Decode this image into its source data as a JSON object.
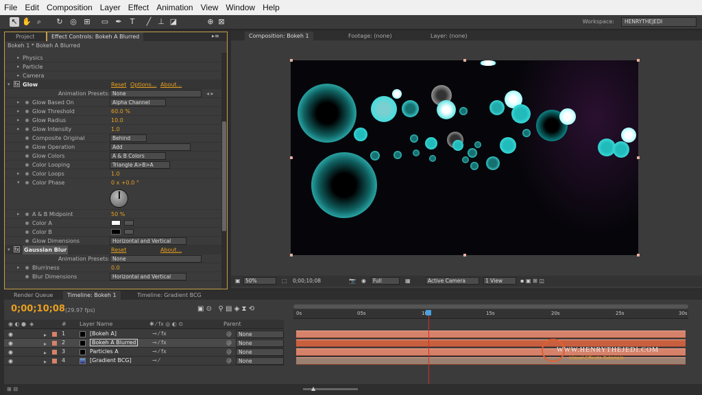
{
  "menu": [
    "File",
    "Edit",
    "Composition",
    "Layer",
    "Effect",
    "Animation",
    "View",
    "Window",
    "Help"
  ],
  "workspace": {
    "label": "Workspace:",
    "value": "HENRYTHEJEDI"
  },
  "left_tabs": {
    "project": "Project",
    "effect_controls": "Effect Controls: Bokeh A Blurred"
  },
  "fx_header": "Bokeh 1 * Bokeh A Blurred",
  "fx_groups": {
    "physics": "Physics",
    "particle": "Particle",
    "camera": "Camera"
  },
  "glow": {
    "title": "Glow",
    "reset": "Reset",
    "options": "Options...",
    "about": "About...",
    "presets_label": "Animation Presets:",
    "presets_value": "None",
    "based_on_label": "Glow Based On",
    "based_on": "Alpha Channel",
    "threshold_label": "Glow Threshold",
    "threshold": "60.0 %",
    "radius_label": "Glow Radius",
    "radius": "10.0",
    "intensity_label": "Glow Intensity",
    "intensity": "1.0",
    "composite_label": "Composite Original",
    "composite": "Behind",
    "operation_label": "Glow Operation",
    "operation": "Add",
    "colors_label": "Glow Colors",
    "colors": "A & B Colors",
    "looping_label": "Color Looping",
    "looping": "Triangle A>B>A",
    "loops_label": "Color Loops",
    "loops": "1.0",
    "phase_label": "Color Phase",
    "phase": "0 x +0.0 °",
    "midpoint_label": "A & B Midpoint",
    "midpoint": "50 %",
    "color_a_label": "Color A",
    "color_b_label": "Color B",
    "dimensions_label": "Glow Dimensions",
    "dimensions": "Horizontal and Vertical"
  },
  "blur": {
    "title": "Gaussian Blur",
    "reset": "Reset",
    "about": "About...",
    "presets_label": "Animation Presets:",
    "presets_value": "None",
    "blurriness_label": "Blurriness",
    "blurriness": "0.0",
    "dimensions_label": "Blur Dimensions",
    "dimensions": "Horizontal and Vertical"
  },
  "comp_tabs": {
    "composition": "Composition: Bokeh 1",
    "footage": "Footage: (none)",
    "layer": "Layer: (none)"
  },
  "comp_footer": {
    "zoom": "50%",
    "time": "0;00;10;08",
    "resolution": "Full",
    "camera": "Active Camera",
    "view": "1 View"
  },
  "timeline_tabs": {
    "render": "Render Queue",
    "bokeh": "Timeline: Bokeh 1",
    "gradient": "Timeline: Gradient BCG"
  },
  "timecode": "0;00;10;08",
  "fps": "(29.97 fps)",
  "columns": {
    "num": "#",
    "layer_name": "Layer Name",
    "parent": "Parent"
  },
  "layers": [
    {
      "num": "1",
      "name": "[Bokeh A]",
      "parent": "None"
    },
    {
      "num": "2",
      "name": "Bokeh A Blurred",
      "parent": "None"
    },
    {
      "num": "3",
      "name": "Particles A",
      "parent": "None"
    },
    {
      "num": "4",
      "name": "[Gradient BCG]",
      "parent": "None"
    }
  ],
  "ruler": [
    "0s",
    "05s",
    "10s",
    "15s",
    "20s",
    "25s",
    "30s"
  ],
  "watermark": {
    "url": "WWW.HENRYTHEJEDI.COM",
    "tagline": "Visual Effects Tutorials"
  },
  "colors": {
    "accent": "#e8a020",
    "glow": "#40e0e0",
    "layer_bar": "#d6826a",
    "playhead": "#d03020"
  }
}
